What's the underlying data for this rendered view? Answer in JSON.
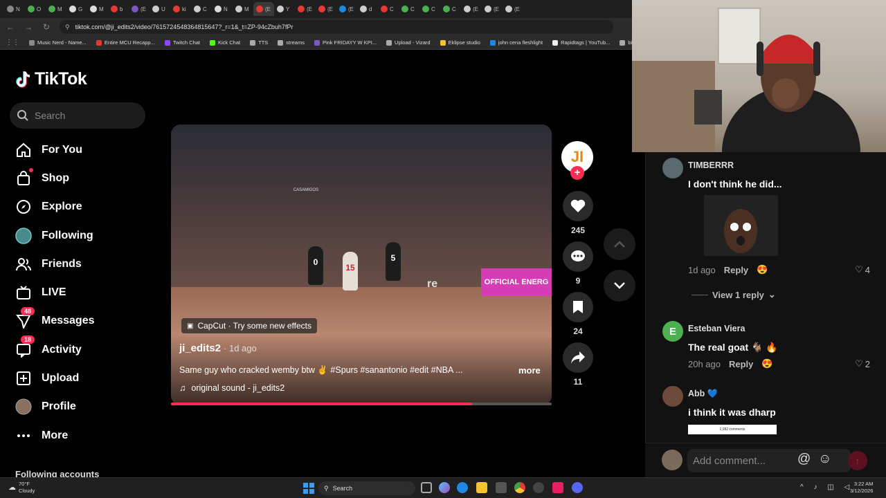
{
  "browser": {
    "url": "tiktok.com/@ji_edits2/video/7615724548364815647?_r=1&_t=ZP-94cZbuh7fPr",
    "tabs": [
      "N",
      "O",
      "M",
      "G",
      "M",
      "b",
      "(E",
      "U",
      "ki",
      "C",
      "N",
      "M",
      "(E",
      "Y",
      "(E",
      "(E",
      "(E",
      "d",
      "C",
      "C",
      "C",
      "C",
      "(E",
      "(E",
      "(E"
    ],
    "bookmarks": [
      "Music Nerd - Name...",
      "Entire MCU Recapp...",
      "Twitch Chat",
      "Kick Chat",
      "TTS",
      "streams",
      "Pink FRIDAYY W KPI...",
      "Upload - Vizard",
      "Eklipse studio",
      "john cena fleshlight",
      "Rapidtags | YouTub...",
      "bih links"
    ]
  },
  "sidebar": {
    "logo": "TikTok",
    "search_placeholder": "Search",
    "items": [
      {
        "label": "For You",
        "icon": "home-icon"
      },
      {
        "label": "Shop",
        "icon": "shop-icon"
      },
      {
        "label": "Explore",
        "icon": "compass-icon"
      },
      {
        "label": "Following",
        "icon": "following-avatar-icon"
      },
      {
        "label": "Friends",
        "icon": "friends-icon"
      },
      {
        "label": "LIVE",
        "icon": "live-icon"
      },
      {
        "label": "Messages",
        "icon": "messages-icon",
        "badge": "48"
      },
      {
        "label": "Activity",
        "icon": "activity-icon",
        "badge": "18"
      },
      {
        "label": "Upload",
        "icon": "upload-icon"
      },
      {
        "label": "Profile",
        "icon": "profile-avatar-icon"
      },
      {
        "label": "More",
        "icon": "more-icon"
      }
    ],
    "following_accounts": "Following accounts"
  },
  "video": {
    "capcut": "CapCut · Try some new effects",
    "author": "ji_edits2",
    "age": "· 1d ago",
    "caption": "Same guy who cracked wemby btw ✌️ #Spurs #sanantonio #edit #NBA ...",
    "more": "more",
    "sound": "original sound - ji_edits2",
    "progress": 0.79,
    "overlay_ad": "OFFICIAL ENERG",
    "overlay_ret": "re",
    "overlay_sponsor": "CASAMIGOS",
    "jersey_numbers": [
      "0",
      "15",
      "5"
    ]
  },
  "actions": {
    "likes": "245",
    "comments": "9",
    "saves": "24",
    "shares": "11",
    "avatar_letters": "JI"
  },
  "comments": [
    {
      "name": "TIMBERRR",
      "text": "I don't think he did...",
      "time": "1d ago",
      "reply": "Reply",
      "likes": "4"
    },
    {
      "name": "Esteban Viera",
      "text": "The real goat 🐐 🔥",
      "time": "20h ago",
      "reply": "Reply",
      "likes": "2",
      "initial": "E"
    },
    {
      "name": "Abb 💙",
      "text": "i think it was dharp"
    }
  ],
  "view_reply": "View 1 reply",
  "comment_input_placeholder": "Add comment...",
  "comment_attachment_text": "2,082 comments",
  "taskbar": {
    "temperature": "70°F",
    "weather": "Cloudy",
    "search": "Search",
    "time": "3:22 AM",
    "date": "3/12/2026"
  },
  "colors": {
    "accent": "#fe2c55",
    "background": "#000000"
  }
}
